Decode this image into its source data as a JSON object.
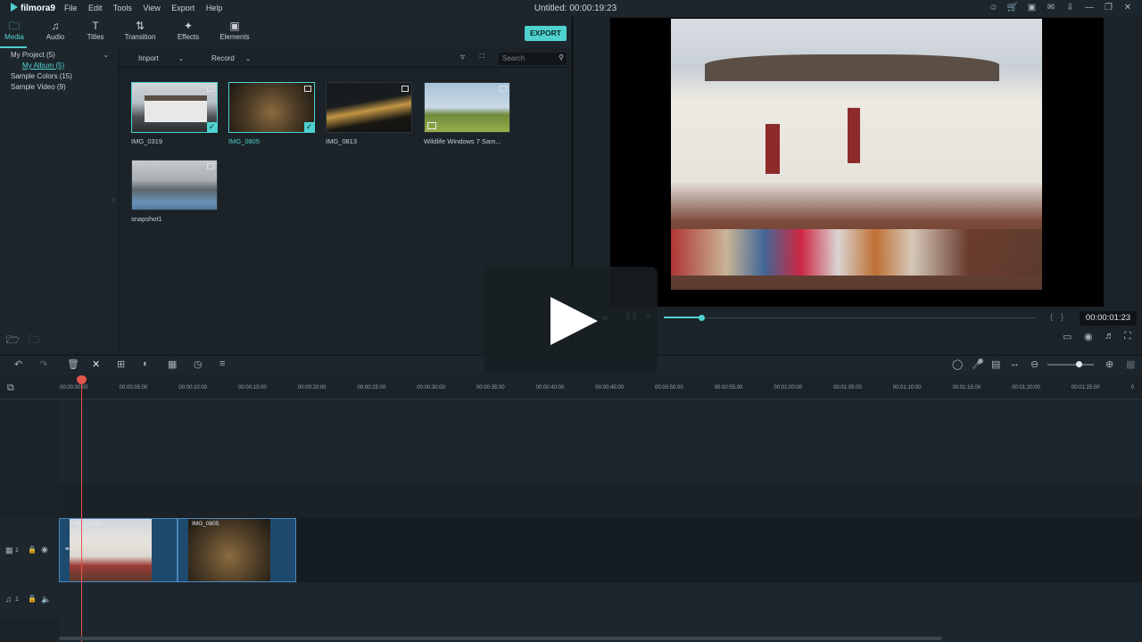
{
  "app": {
    "name": "filmora9",
    "doc_title": "Untitled:",
    "doc_time": "00:00:19:23"
  },
  "menu": [
    "File",
    "Edit",
    "Tools",
    "View",
    "Export",
    "Help"
  ],
  "tabs": [
    {
      "label": "Media",
      "icon": "folder-icon"
    },
    {
      "label": "Audio",
      "icon": "music-note-icon"
    },
    {
      "label": "Titles",
      "icon": "text-icon"
    },
    {
      "label": "Transition",
      "icon": "transition-icon"
    },
    {
      "label": "Effects",
      "icon": "effects-icon"
    },
    {
      "label": "Elements",
      "icon": "image-icon"
    }
  ],
  "export_label": "EXPORT",
  "project_tree": {
    "project": "My Project (5)",
    "album": "My Album (5)",
    "colors": "Sample Colors (15)",
    "video": "Sample Video (9)"
  },
  "media_toolbar": {
    "import": "Import",
    "record": "Record",
    "search_placeholder": "Search"
  },
  "media": [
    {
      "name": "IMG_0319",
      "selected": true
    },
    {
      "name": "IMG_0805",
      "selected": true
    },
    {
      "name": "IMG_0813",
      "selected": false
    },
    {
      "name": "Wildlife Windows 7 Sam...",
      "selected": false
    },
    {
      "name": "snapshot1",
      "selected": false
    }
  ],
  "player": {
    "time": "00:00:01:23",
    "progress": 0.1
  },
  "ruler_ticks": [
    "00:00:00:00",
    "00:00:05:00",
    "00:00:10:00",
    "00:00:15:00",
    "00:00:20:00",
    "00:00:25:00",
    "00:00:30:00",
    "00:00:35:00",
    "00:00:40:00",
    "00:00:45:00",
    "00:00:50:00",
    "00:00:55:00",
    "00:01:00:00",
    "00:01:05:00",
    "00:01:10:00",
    "00:01:15:00",
    "00:01:20:00",
    "00:01:25:00",
    "0"
  ],
  "clips": [
    {
      "name": "IMG_0319"
    },
    {
      "name": "IMG_0805"
    }
  ],
  "track_labels": {
    "video": "1",
    "audio": "1"
  },
  "colors": {
    "accent": "#4fd2cf",
    "playhead": "#e2574c",
    "clip": "#1e4a6e"
  }
}
